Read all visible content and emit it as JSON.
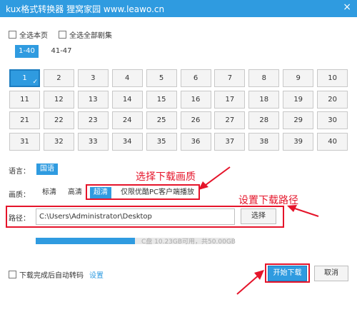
{
  "window": {
    "title": "kux格式转换器 狸窝家园 www.leawo.cn",
    "close": "×"
  },
  "options": {
    "select_page": "全选本页",
    "select_all": "全选全部剧集"
  },
  "range_tabs": [
    {
      "label": "1-40",
      "active": true
    },
    {
      "label": "41-47",
      "active": false
    }
  ],
  "episodes": [
    {
      "label": "1",
      "selected": true
    },
    {
      "label": "2"
    },
    {
      "label": "3"
    },
    {
      "label": "4"
    },
    {
      "label": "5"
    },
    {
      "label": "6"
    },
    {
      "label": "7"
    },
    {
      "label": "8"
    },
    {
      "label": "9"
    },
    {
      "label": "10"
    },
    {
      "label": "11"
    },
    {
      "label": "12"
    },
    {
      "label": "13"
    },
    {
      "label": "14"
    },
    {
      "label": "15"
    },
    {
      "label": "16"
    },
    {
      "label": "17"
    },
    {
      "label": "18"
    },
    {
      "label": "19"
    },
    {
      "label": "20"
    },
    {
      "label": "21"
    },
    {
      "label": "22"
    },
    {
      "label": "23"
    },
    {
      "label": "24"
    },
    {
      "label": "25"
    },
    {
      "label": "26"
    },
    {
      "label": "27"
    },
    {
      "label": "28"
    },
    {
      "label": "29"
    },
    {
      "label": "30"
    },
    {
      "label": "31"
    },
    {
      "label": "32"
    },
    {
      "label": "33"
    },
    {
      "label": "34"
    },
    {
      "label": "35"
    },
    {
      "label": "36"
    },
    {
      "label": "37"
    },
    {
      "label": "38"
    },
    {
      "label": "39"
    },
    {
      "label": "40"
    }
  ],
  "language": {
    "label": "语言：",
    "value": "国语"
  },
  "quality": {
    "label": "画质：",
    "options": [
      "标清",
      "高清",
      "超清",
      "仅限优酷PC客户端播放"
    ],
    "selected": "超清"
  },
  "annotations": {
    "quality": "选择下载画质",
    "path": "设置下载路径"
  },
  "path": {
    "label": "路径：",
    "value": "C:\\Users\\Administrator\\Desktop",
    "choose": "选择"
  },
  "disk": {
    "text": "C盘 10.23GB可用，共50.00GB",
    "used_fraction": 0.5
  },
  "footer": {
    "auto_convert": "下载完成后自动转码",
    "settings": "设置",
    "start": "开始下载",
    "cancel": "取消"
  },
  "colors": {
    "accent": "#2f9be0",
    "annotation": "#e5142a"
  }
}
